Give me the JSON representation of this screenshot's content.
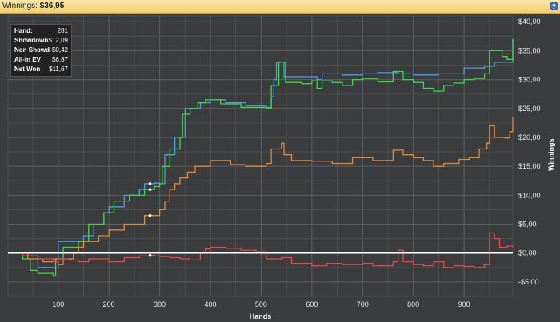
{
  "header": {
    "title_label": "Winnings:",
    "title_value": "$36,95",
    "help_icon": "?"
  },
  "stats_box": {
    "rows": [
      {
        "label": "Hand:",
        "value": "281"
      },
      {
        "label": "Showdown",
        "value": "$12,09"
      },
      {
        "label": "Non Showdown",
        "value": "-$0,42"
      },
      {
        "label": "All-In EV",
        "value": "$6,87"
      },
      {
        "label": "Net Won",
        "value": "$11,67"
      }
    ]
  },
  "colors": {
    "background": "#3b3c3e",
    "grid": "#5a5b5d",
    "zero_line": "#ffffff",
    "text": "#e6e6e6"
  },
  "chart_data": {
    "type": "line",
    "xlabel": "Hands",
    "ylabel": "Winnings",
    "xlim": [
      1,
      996
    ],
    "ylim": [
      -7.5,
      41
    ],
    "x_ticks": [
      100,
      200,
      300,
      400,
      500,
      600,
      700,
      800,
      900
    ],
    "x_tick_labels": [
      "100",
      "200",
      "300",
      "400",
      "500",
      "600",
      "700",
      "800",
      "900"
    ],
    "y_ticks": [
      -5,
      0,
      5,
      10,
      15,
      20,
      25,
      30,
      35,
      40
    ],
    "y_tick_labels": [
      "-$5,00",
      "$0,00",
      "$5,00",
      "$10,00",
      "$15,00",
      "$20,00",
      "$25,00",
      "$30,00",
      "$35,00",
      "$40,00"
    ],
    "y_axis_side": "right",
    "grid": true,
    "marker_hand": 281,
    "series": [
      {
        "color": "#4d9de0",
        "values": [
          [
            1,
            0
          ],
          [
            30,
            -0.5
          ],
          [
            60,
            -2.5
          ],
          [
            95,
            -2.6
          ],
          [
            100,
            2
          ],
          [
            150,
            3
          ],
          [
            170,
            5
          ],
          [
            190,
            7
          ],
          [
            200,
            8
          ],
          [
            230,
            10
          ],
          [
            260,
            11
          ],
          [
            270,
            12
          ],
          [
            290,
            12.1
          ],
          [
            300,
            12
          ],
          [
            310,
            17
          ],
          [
            330,
            20
          ],
          [
            350,
            25
          ],
          [
            370,
            25
          ],
          [
            380,
            26
          ],
          [
            400,
            26.5
          ],
          [
            430,
            26
          ],
          [
            470,
            25.5
          ],
          [
            510,
            25.2
          ],
          [
            520,
            27
          ],
          [
            525,
            30
          ],
          [
            530,
            33
          ],
          [
            545,
            30.5
          ],
          [
            580,
            30.5
          ],
          [
            610,
            30
          ],
          [
            620,
            31
          ],
          [
            660,
            30.8
          ],
          [
            700,
            31
          ],
          [
            730,
            31.2
          ],
          [
            770,
            31
          ],
          [
            800,
            30.8
          ],
          [
            850,
            31
          ],
          [
            900,
            32
          ],
          [
            940,
            32.3
          ],
          [
            960,
            33
          ],
          [
            985,
            33
          ],
          [
            996,
            37
          ]
        ]
      },
      {
        "color": "#3fd64a",
        "values": [
          [
            1,
            0
          ],
          [
            30,
            -1
          ],
          [
            45,
            -3
          ],
          [
            60,
            -3.5
          ],
          [
            90,
            -4
          ],
          [
            95,
            -1
          ],
          [
            110,
            1
          ],
          [
            140,
            2
          ],
          [
            160,
            5
          ],
          [
            190,
            7
          ],
          [
            210,
            9
          ],
          [
            240,
            10
          ],
          [
            270,
            11
          ],
          [
            290,
            11.5
          ],
          [
            300,
            12
          ],
          [
            305,
            15
          ],
          [
            320,
            18
          ],
          [
            340,
            20
          ],
          [
            345,
            24
          ],
          [
            360,
            25
          ],
          [
            375,
            26
          ],
          [
            390,
            26.5
          ],
          [
            420,
            25.8
          ],
          [
            460,
            25.2
          ],
          [
            510,
            25
          ],
          [
            520,
            29
          ],
          [
            535,
            33
          ],
          [
            548,
            29.5
          ],
          [
            580,
            29.3
          ],
          [
            600,
            29.8
          ],
          [
            610,
            28.5
          ],
          [
            620,
            29.8
          ],
          [
            640,
            29.5
          ],
          [
            660,
            29
          ],
          [
            680,
            30
          ],
          [
            700,
            30.2
          ],
          [
            730,
            29.6
          ],
          [
            760,
            31.4
          ],
          [
            780,
            30
          ],
          [
            800,
            29.5
          ],
          [
            820,
            28.5
          ],
          [
            840,
            28
          ],
          [
            860,
            29
          ],
          [
            880,
            29.4
          ],
          [
            900,
            30
          ],
          [
            920,
            30.2
          ],
          [
            940,
            31
          ],
          [
            950,
            35
          ],
          [
            975,
            34
          ],
          [
            985,
            33.5
          ],
          [
            996,
            37
          ]
        ]
      },
      {
        "color": "#e08a3c",
        "values": [
          [
            1,
            0
          ],
          [
            40,
            -1
          ],
          [
            70,
            -1.5
          ],
          [
            90,
            -1
          ],
          [
            100,
            -2
          ],
          [
            110,
            -1
          ],
          [
            130,
            0
          ],
          [
            140,
            1
          ],
          [
            150,
            2
          ],
          [
            180,
            3
          ],
          [
            200,
            4
          ],
          [
            230,
            5
          ],
          [
            270,
            6.5
          ],
          [
            300,
            7.5
          ],
          [
            310,
            9
          ],
          [
            320,
            11
          ],
          [
            330,
            12
          ],
          [
            340,
            13
          ],
          [
            355,
            14
          ],
          [
            370,
            15
          ],
          [
            400,
            16
          ],
          [
            440,
            15.3
          ],
          [
            470,
            15
          ],
          [
            510,
            15.5
          ],
          [
            520,
            18
          ],
          [
            540,
            19
          ],
          [
            545,
            17
          ],
          [
            560,
            16
          ],
          [
            600,
            15.9
          ],
          [
            640,
            15.5
          ],
          [
            680,
            16.5
          ],
          [
            720,
            16
          ],
          [
            760,
            17.8
          ],
          [
            780,
            17
          ],
          [
            800,
            16.5
          ],
          [
            820,
            16
          ],
          [
            840,
            15
          ],
          [
            860,
            15.5
          ],
          [
            890,
            16.2
          ],
          [
            910,
            16.5
          ],
          [
            930,
            18
          ],
          [
            945,
            19
          ],
          [
            950,
            22
          ],
          [
            960,
            20
          ],
          [
            970,
            20
          ],
          [
            980,
            19.9
          ],
          [
            990,
            21
          ],
          [
            996,
            23.5
          ]
        ]
      },
      {
        "color": "#e04b4b",
        "values": [
          [
            1,
            0
          ],
          [
            30,
            -0.5
          ],
          [
            60,
            -1
          ],
          [
            90,
            -1.5
          ],
          [
            100,
            -1
          ],
          [
            120,
            -1.2
          ],
          [
            140,
            -1.5
          ],
          [
            160,
            -1
          ],
          [
            180,
            -1
          ],
          [
            200,
            -1.5
          ],
          [
            230,
            -0.8
          ],
          [
            260,
            -0.5
          ],
          [
            281,
            -0.4
          ],
          [
            290,
            -0.5
          ],
          [
            300,
            -0.6
          ],
          [
            320,
            -0.8
          ],
          [
            340,
            -1
          ],
          [
            360,
            -1.2
          ],
          [
            380,
            0
          ],
          [
            390,
            0.7
          ],
          [
            400,
            1
          ],
          [
            430,
            0.8
          ],
          [
            460,
            0.5
          ],
          [
            490,
            0.2
          ],
          [
            510,
            -1
          ],
          [
            540,
            -0.8
          ],
          [
            560,
            -1.8
          ],
          [
            600,
            -2.2
          ],
          [
            630,
            -1.8
          ],
          [
            660,
            -2
          ],
          [
            700,
            -1.8
          ],
          [
            720,
            -2.2
          ],
          [
            760,
            -1.5
          ],
          [
            770,
            0.5
          ],
          [
            780,
            -1.5
          ],
          [
            800,
            -2
          ],
          [
            820,
            -2.2
          ],
          [
            840,
            -1.5
          ],
          [
            860,
            -2.5
          ],
          [
            880,
            -2.2
          ],
          [
            900,
            -2.3
          ],
          [
            920,
            -2.5
          ],
          [
            940,
            -2
          ],
          [
            950,
            3.5
          ],
          [
            960,
            2.5
          ],
          [
            970,
            1
          ],
          [
            985,
            1.2
          ],
          [
            996,
            1
          ]
        ]
      }
    ]
  }
}
